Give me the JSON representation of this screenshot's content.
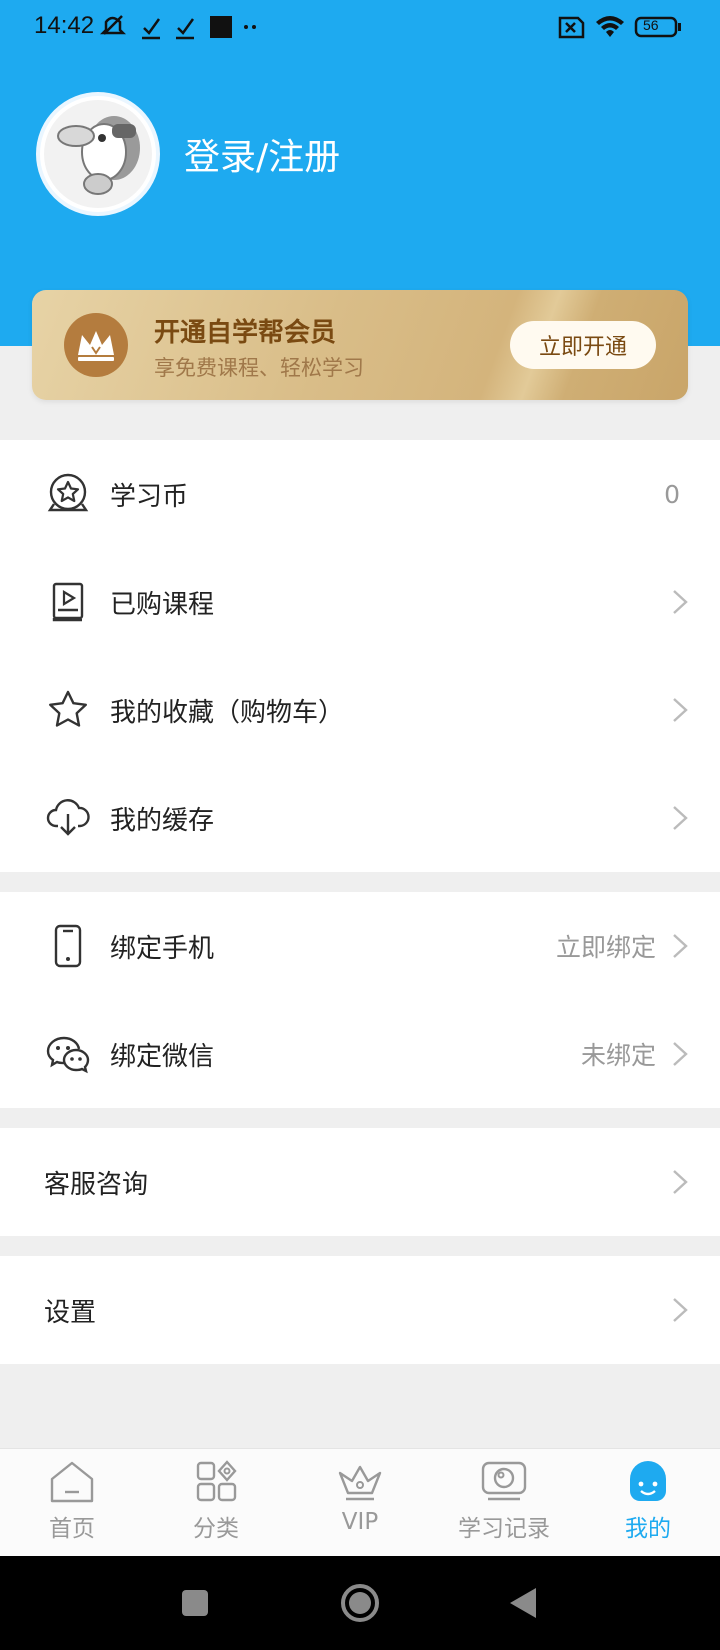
{
  "status_bar": {
    "time": "14:42",
    "battery": "56"
  },
  "profile": {
    "login_label": "登录/注册"
  },
  "vip_card": {
    "title": "开通自学帮会员",
    "subtitle": "享免费课程、轻松学习",
    "button": "立即开通"
  },
  "menu_main": [
    {
      "label": "学习币",
      "value": "0",
      "icon": "coin-star-icon"
    },
    {
      "label": "已购课程",
      "icon": "purchased-course-icon"
    },
    {
      "label": "我的收藏（购物车）",
      "icon": "star-icon"
    },
    {
      "label": "我的缓存",
      "icon": "cloud-download-icon"
    }
  ],
  "menu_bind": [
    {
      "label": "绑定手机",
      "value": "立即绑定",
      "icon": "phone-icon"
    },
    {
      "label": "绑定微信",
      "value": "未绑定",
      "icon": "wechat-icon"
    }
  ],
  "menu_service": {
    "label": "客服咨询"
  },
  "menu_settings": {
    "label": "设置"
  },
  "bottom_nav": [
    {
      "label": "首页",
      "icon": "home-icon"
    },
    {
      "label": "分类",
      "icon": "category-icon"
    },
    {
      "label": "VIP",
      "icon": "crown-icon"
    },
    {
      "label": "学习记录",
      "icon": "study-record-icon"
    },
    {
      "label": "我的",
      "icon": "mine-face-icon",
      "active": true
    }
  ],
  "colors": {
    "primary": "#1eaaf0",
    "gold": "#d4b47c",
    "text": "#222222",
    "muted": "#999999"
  }
}
